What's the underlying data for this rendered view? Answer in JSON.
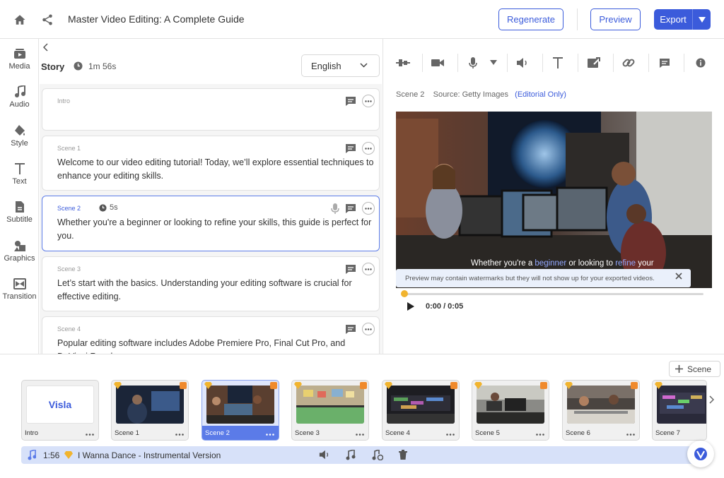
{
  "header": {
    "title": "Master Video Editing: A Complete Guide",
    "regenerate_label": "Regenerate",
    "preview_label": "Preview",
    "export_label": "Export"
  },
  "rail": {
    "items": [
      {
        "label": "Media",
        "icon": "media-icon"
      },
      {
        "label": "Audio",
        "icon": "music-note-icon"
      },
      {
        "label": "Style",
        "icon": "paint-bucket-icon"
      },
      {
        "label": "Text",
        "icon": "text-icon"
      },
      {
        "label": "Subtitle",
        "icon": "document-icon"
      },
      {
        "label": "Graphics",
        "icon": "shapes-icon"
      },
      {
        "label": "Transition",
        "icon": "transition-icon"
      }
    ]
  },
  "story": {
    "label": "Story",
    "duration": "1m 56s",
    "language": "English",
    "cards": [
      {
        "name": "Intro",
        "text": ""
      },
      {
        "name": "Scene 1",
        "text": "Welcome to our video editing tutorial! Today, we’ll explore essential techniques to enhance your editing skills."
      },
      {
        "name": "Scene 2",
        "duration": "5s",
        "text": "Whether you're a beginner or looking to refine your skills, this guide is perfect for you."
      },
      {
        "name": "Scene 3",
        "text": "Let’s start with the basics. Understanding your editing software is crucial for effective editing."
      },
      {
        "name": "Scene 4",
        "text": "Popular editing software includes Adobe Premiere Pro, Final Cut Pro, and DaVinci Resolve."
      }
    ]
  },
  "preview": {
    "scene": "Scene 2",
    "source": "Source: Getty Images",
    "editorial": "(Editorial Only)",
    "caption_pre": "Whether you're a ",
    "caption_hl1": "beginner",
    "caption_mid": " or looking to ",
    "caption_hl2": "refine",
    "caption_post": " your",
    "watermark_note": "Preview may contain watermarks but they will not show up for your exported videos.",
    "time": "0:00 / 0:05",
    "progress": 0.0
  },
  "timeline": {
    "add_scene_label": "Scene",
    "thumbnails": [
      {
        "name": "Intro",
        "logo": "Visla"
      },
      {
        "name": "Scene 1"
      },
      {
        "name": "Scene 2"
      },
      {
        "name": "Scene 3"
      },
      {
        "name": "Scene 4"
      },
      {
        "name": "Scene 5"
      },
      {
        "name": "Scene 6"
      },
      {
        "name": "Scene 7"
      }
    ]
  },
  "music": {
    "duration": "1:56",
    "title": "I Wanna Dance - Instrumental Version"
  },
  "colors": {
    "accent": "#3b5bdb",
    "selection": "#5b7be8",
    "premium_gem": "#f1b42f",
    "music_bar": "#d7e1f9"
  }
}
